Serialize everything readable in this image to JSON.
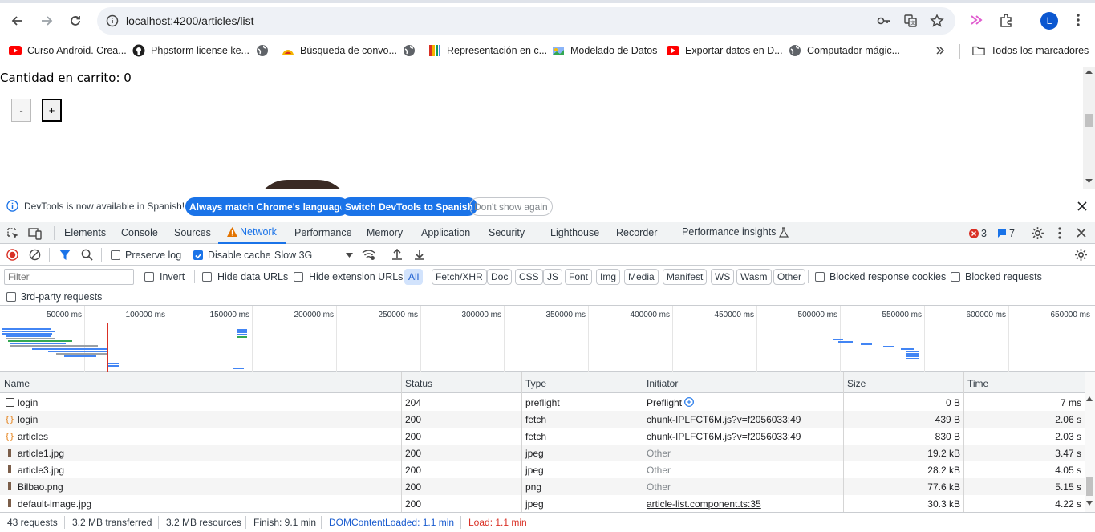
{
  "browser": {
    "url": "localhost:4200/articles/list",
    "avatar_initial": "L",
    "bookmarks": [
      {
        "label": "Curso Android. Crea...",
        "icon": "youtube-icon"
      },
      {
        "label": "Phpstorm license ke...",
        "icon": "github-icon"
      },
      {
        "label": "",
        "icon": "globe-icon"
      },
      {
        "label": "Búsqueda de convo...",
        "icon": "bookmark-favicon"
      },
      {
        "label": "",
        "icon": "globe-icon"
      },
      {
        "label": "Representación en c...",
        "icon": "bookmark-favicon"
      },
      {
        "label": "Modelado de Datos",
        "icon": "bookmark-favicon"
      },
      {
        "label": "Exportar datos en D...",
        "icon": "youtube-icon"
      },
      {
        "label": "Computador mágic...",
        "icon": "globe-icon"
      }
    ],
    "all_bookmarks": "Todos los marcadores"
  },
  "page": {
    "cart_text": "Cantidad en carrito: 0",
    "minus_label": "-",
    "plus_label": "+"
  },
  "devtools": {
    "infobar": {
      "message": "DevTools is now available in Spanish!",
      "btn_match": "Always match Chrome's language",
      "btn_switch": "Switch DevTools to Spanish",
      "btn_dismiss": "Don't show again"
    },
    "tabs": [
      "Elements",
      "Console",
      "Sources",
      "Network",
      "Performance",
      "Memory",
      "Application",
      "Security",
      "Lighthouse",
      "Recorder",
      "Performance insights"
    ],
    "active_tab": "Network",
    "errors": "3",
    "messages": "7",
    "toolbar": {
      "preserve_log": "Preserve log",
      "disable_cache": "Disable cache",
      "throttle": "Slow 3G"
    },
    "filter": {
      "placeholder": "Filter",
      "invert": "Invert",
      "hide_data_urls": "Hide data URLs",
      "hide_ext_urls": "Hide extension URLs",
      "types": [
        "All",
        "Fetch/XHR",
        "Doc",
        "CSS",
        "JS",
        "Font",
        "Img",
        "Media",
        "Manifest",
        "WS",
        "Wasm",
        "Other"
      ],
      "blocked_cookies": "Blocked response cookies",
      "blocked_requests": "Blocked requests",
      "third_party": "3rd-party requests"
    },
    "overview_ticks": [
      "50000 ms",
      "100000 ms",
      "150000 ms",
      "200000 ms",
      "250000 ms",
      "300000 ms",
      "350000 ms",
      "400000 ms",
      "450000 ms",
      "500000 ms",
      "550000 ms",
      "600000 ms",
      "650000 ms"
    ],
    "columns": [
      "Name",
      "Status",
      "Type",
      "Initiator",
      "Size",
      "Time"
    ],
    "rows": [
      {
        "name": "login",
        "status": "204",
        "type": "preflight",
        "initiator": "Preflight",
        "size": "0 B",
        "time": "7 ms"
      },
      {
        "name": "login",
        "status": "200",
        "type": "fetch",
        "initiator": "chunk-IPLFCT6M.js?v=f2056033:49",
        "size": "439 B",
        "time": "2.06 s"
      },
      {
        "name": "articles",
        "status": "200",
        "type": "fetch",
        "initiator": "chunk-IPLFCT6M.js?v=f2056033:49",
        "size": "830 B",
        "time": "2.03 s"
      },
      {
        "name": "article1.jpg",
        "status": "200",
        "type": "jpeg",
        "initiator": "Other",
        "size": "19.2 kB",
        "time": "3.47 s"
      },
      {
        "name": "article3.jpg",
        "status": "200",
        "type": "jpeg",
        "initiator": "Other",
        "size": "28.2 kB",
        "time": "4.05 s"
      },
      {
        "name": "Bilbao.png",
        "status": "200",
        "type": "png",
        "initiator": "Other",
        "size": "77.6 kB",
        "time": "5.15 s"
      },
      {
        "name": "default-image.jpg",
        "status": "200",
        "type": "jpeg",
        "initiator": "article-list.component.ts:35",
        "size": "30.3 kB",
        "time": "4.22 s"
      }
    ],
    "status": {
      "requests": "43 requests",
      "transferred": "3.2 MB transferred",
      "resources": "3.2 MB resources",
      "finish": "Finish: 9.1 min",
      "dcl": "DOMContentLoaded: 1.1 min",
      "load": "Load: 1.1 min"
    }
  }
}
